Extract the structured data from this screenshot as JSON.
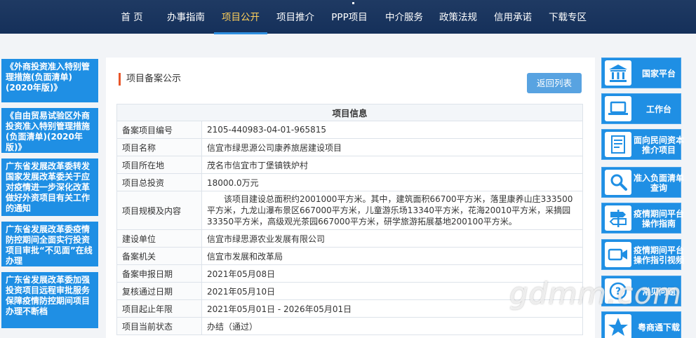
{
  "nav": {
    "items": [
      "首 页",
      "办事指南",
      "项目公开",
      "项目推介",
      "PPP项目",
      "中介服务",
      "政策法规",
      "信用承诺",
      "下载专区"
    ],
    "active_index": 2,
    "colors": {
      "bar": "#1a345e",
      "active_text": "#ffd05a",
      "active_underline": "#2f8fe0"
    }
  },
  "left_links": [
    "《外商投资准入特别管理措施(负面清单)(2020年版)》",
    "《自由贸易试验区外商投资准入特别管理措施(负面清单)(2020年版)》",
    "广东省发展改革委转发国家发展改革委关于应对疫情进一步深化改革做好外资项目有关工作的通知",
    "广东省发展改革委疫情防控期间全面实行投资项目审批“不见面”在线办理",
    "广东省发展改革委加强投资项目远程审批服务保障疫情防控期间项目办理不断档"
  ],
  "main": {
    "section_title": "项目备案公示",
    "back_button": "返回列表",
    "table_header": "项目信息",
    "rows": [
      {
        "key": "备案项目编号",
        "value": "2105-440983-04-01-965815"
      },
      {
        "key": "项目名称",
        "value": "信宜市绿思源公司康养旅居建设项目"
      },
      {
        "key": "项目所在地",
        "value": "茂名市信宜市丁堡镇铁炉村"
      },
      {
        "key": "项目总投资",
        "value": "18000.0万元"
      },
      {
        "key": "项目规模及内容",
        "value": "　　该项目建设总面积约2001000平方米。其中，建筑面积66700平方米，落里康养山庄333500平方米，九龙山瀑布景区667000平方米，儿童游乐场13340平方米，花海20010平方米，采摘园33350平方米，高级观光茶园667000平方米，研学旅游拓展基地200100平方米。"
      },
      {
        "key": "建设单位",
        "value": "信宜市绿思源农业发展有限公司"
      },
      {
        "key": "备案机关",
        "value": "信宜市发展和改革局"
      },
      {
        "key": "备案申报日期",
        "value": "2021年05月08日"
      },
      {
        "key": "复核通过日期",
        "value": "2021年05月10日"
      },
      {
        "key": "项目起止年限",
        "value": "2021年05月01日 - 2026年05月01日"
      },
      {
        "key": "项目当前状态",
        "value": "办结（通过）"
      }
    ]
  },
  "right_buttons": [
    {
      "label": "国家平台",
      "icon": "government-building-icon"
    },
    {
      "label": "工作台",
      "icon": "laptop-icon"
    },
    {
      "label": "面向民间资本推介项目",
      "icon": "document-list-icon"
    },
    {
      "label": "准入负面清单查询",
      "icon": "search-icon"
    },
    {
      "label": "疫情期间平台操作指南",
      "icon": "signpost-icon"
    },
    {
      "label": "疫情期间平台操作指引视频",
      "icon": "video-camera-icon"
    },
    {
      "label": "常见问题",
      "icon": "question-icon"
    },
    {
      "label": "粤商通下载",
      "icon": "app-logo-icon"
    }
  ],
  "watermark": "gdmm.com"
}
